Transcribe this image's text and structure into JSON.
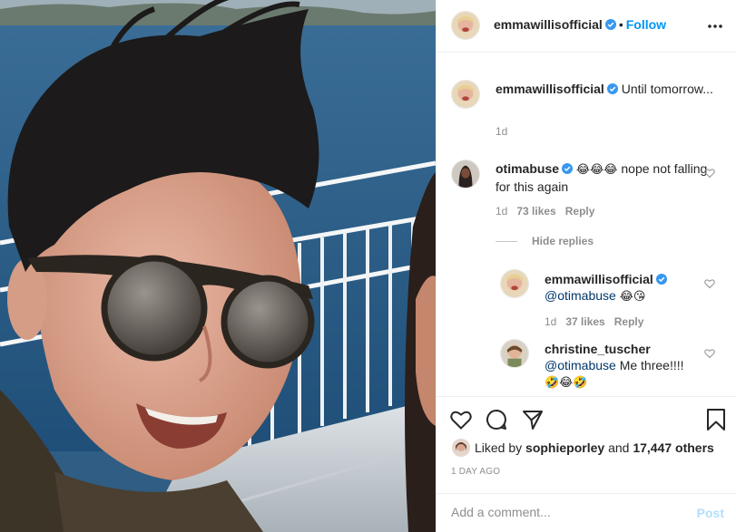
{
  "header": {
    "username": "emmawillisofficial",
    "separator": "•",
    "follow_label": "Follow",
    "more_icon": "more-horizontal-icon"
  },
  "caption": {
    "username": "emmawillisofficial",
    "text": "Until tomorrow...",
    "time": "1d"
  },
  "comments": [
    {
      "username": "otimabuse",
      "emoji": "😂😂😂",
      "text": "nope not falling for this again",
      "time": "1d",
      "likes": "73 likes",
      "reply_label": "Reply"
    }
  ],
  "hide_replies_label": "Hide replies",
  "replies": [
    {
      "username": "emmawillisofficial",
      "mention": "@otimabuse",
      "emoji": "😂😘",
      "time": "1d",
      "likes": "37 likes",
      "reply_label": "Reply"
    },
    {
      "username": "christine_tuscher",
      "mention": "@otimabuse",
      "text": "Me three!!!!",
      "emoji": "🤣😂🤣"
    }
  ],
  "actions": {
    "icons": [
      "heart-icon",
      "comment-icon",
      "share-icon",
      "bookmark-icon"
    ],
    "liked_by_prefix": "Liked by",
    "liked_by_user": "sophieporley",
    "liked_by_and": "and",
    "liked_by_count": "17,447 others",
    "date": "1 DAY AGO"
  },
  "comment_box": {
    "placeholder": "Add a comment...",
    "post_label": "Post"
  },
  "colors": {
    "link_blue": "#0095f6",
    "post_disabled": "#b2dffc",
    "muted": "#8e8e8e",
    "text": "#262626",
    "verified": "#3897f0"
  }
}
